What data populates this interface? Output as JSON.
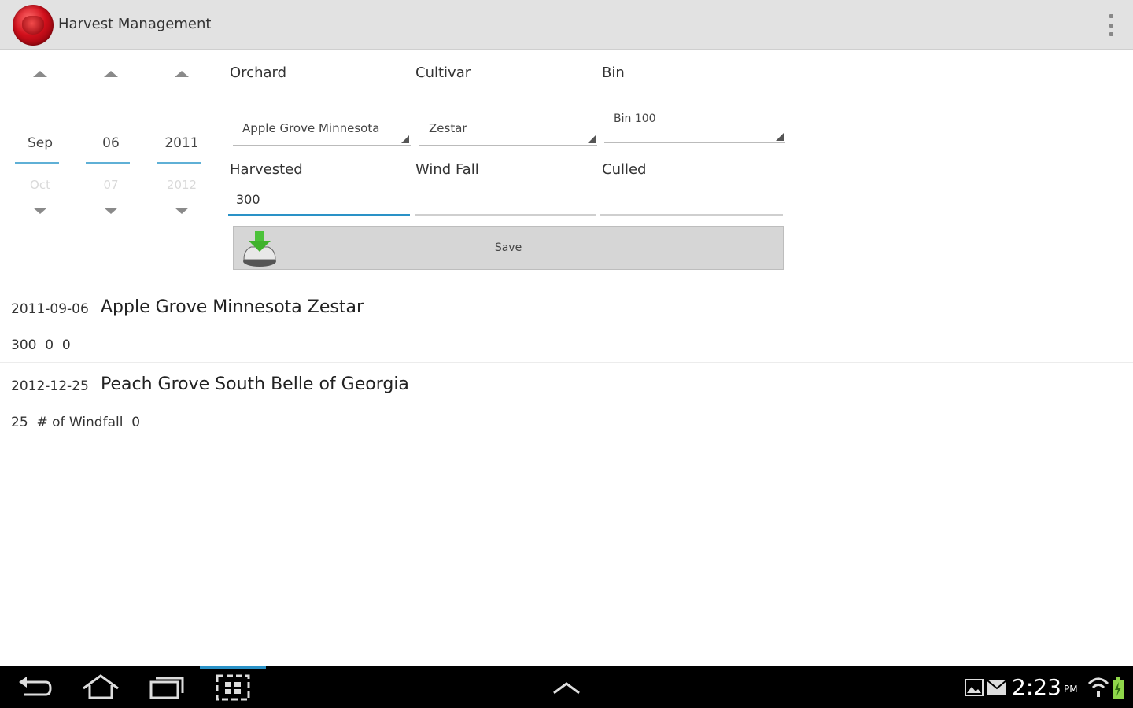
{
  "app": {
    "title": "Harvest Management"
  },
  "date_picker": {
    "month": {
      "current": "Sep",
      "next": "Oct"
    },
    "day": {
      "current": "06",
      "next": "07"
    },
    "year": {
      "current": "2011",
      "next": "2012"
    }
  },
  "form": {
    "orchard": {
      "label": "Orchard",
      "value": "Apple Grove Minnesota"
    },
    "cultivar": {
      "label": "Cultivar",
      "value": "Zestar"
    },
    "bin": {
      "label": "Bin",
      "value": "Bin 100"
    },
    "harvested": {
      "label": "Harvested",
      "value": "300"
    },
    "windfall": {
      "label": "Wind Fall",
      "value": ""
    },
    "culled": {
      "label": "Culled",
      "value": ""
    },
    "save_label": "Save"
  },
  "records": [
    {
      "date": "2011-09-06",
      "title": "Apple Grove Minnesota  Zestar",
      "detail": "300  0  0"
    },
    {
      "date": "2012-12-25",
      "title": "Peach Grove South  Belle of Georgia",
      "detail": "25  # of Windfall  0"
    }
  ],
  "status": {
    "time": "2:23",
    "ampm": "PM"
  },
  "colors": {
    "accent": "#2a92c7",
    "action_bar": "#e2e2e2",
    "save_button": "#d6d6d6"
  }
}
